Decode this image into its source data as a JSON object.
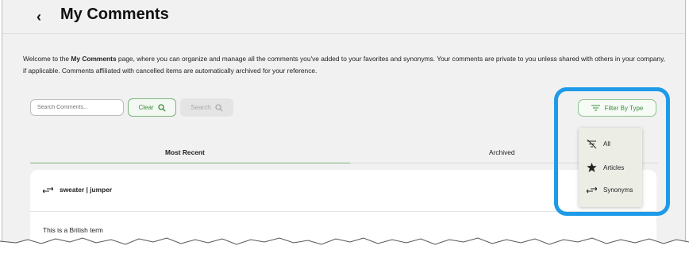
{
  "header": {
    "back_glyph": "‹",
    "title": "My Comments"
  },
  "intro": {
    "before": "Welcome to the ",
    "bold": "My Comments",
    "after": " page, where you can organize and manage all the comments you've added to your favorites and synonyms. Your comments are private to you unless shared with others in your company, if applicable. Comments affiliated with cancelled items are automatically archived for your reference."
  },
  "toolbar": {
    "search_placeholder": "Search Comments...",
    "clear_label": "Clear",
    "search_label": "Search",
    "filter_label": "Filter By Type"
  },
  "tabs": [
    {
      "label": "Most Recent",
      "active": true
    },
    {
      "label": "Archived",
      "active": false
    }
  ],
  "comment": {
    "term": "sweater | jumper",
    "text": "This is a British term"
  },
  "filter_menu": {
    "items": [
      {
        "label": "All",
        "icon": "filter-off-icon"
      },
      {
        "label": "Articles",
        "icon": "star-icon"
      },
      {
        "label": "Synonyms",
        "icon": "swap-arrows-icon"
      }
    ]
  },
  "colors": {
    "accent_green": "#3e8c3e",
    "highlight_blue": "#1e9be8",
    "page_bg": "#f1f1f1"
  }
}
